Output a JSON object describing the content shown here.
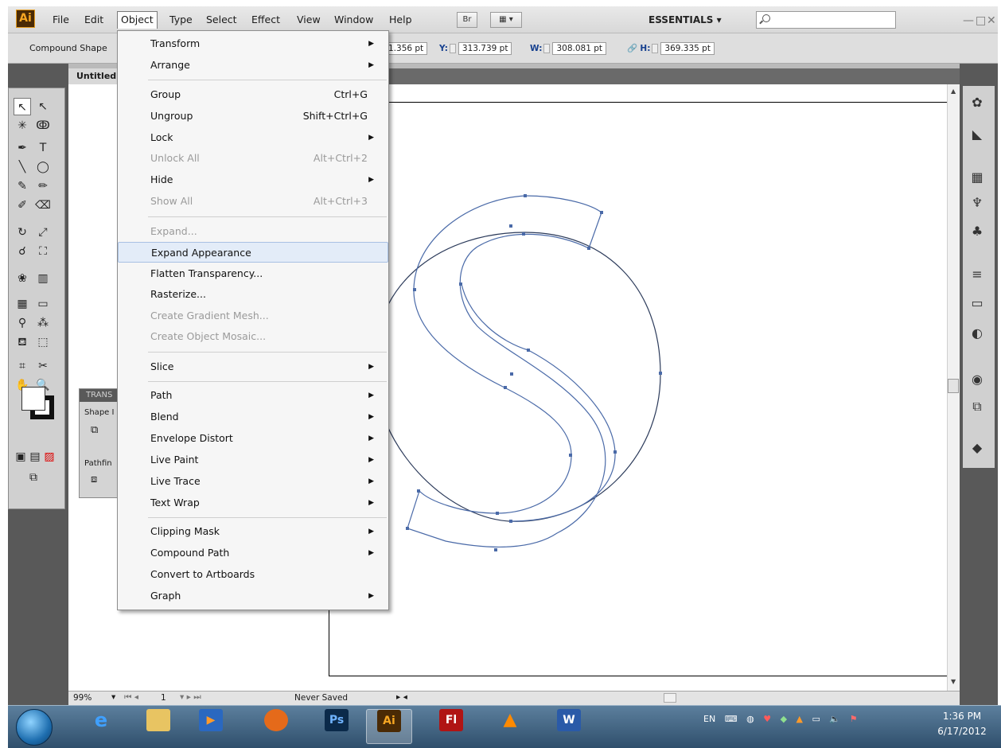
{
  "app": {
    "logo_text": "Ai",
    "menus": [
      "File",
      "Edit",
      "Object",
      "Type",
      "Select",
      "Effect",
      "View",
      "Window",
      "Help"
    ],
    "bridge_label": "Br",
    "workspace": "ESSENTIALS ▾",
    "search_placeholder": ""
  },
  "control_bar": {
    "label": "Compound Shape",
    "x_value": "1.356 pt",
    "y_label": "Y:",
    "y_value": "313.739 pt",
    "w_label": "W:",
    "w_value": "308.081 pt",
    "h_label": "H:",
    "h_value": "369.335 pt"
  },
  "document": {
    "tab": "Untitled"
  },
  "status_bar": {
    "zoom": "99%",
    "page": "1",
    "doc_status": "Never Saved"
  },
  "transform_panel": {
    "title": "TRANS",
    "shape_label": "Shape I",
    "pathfinder_label": "Pathfin"
  },
  "object_menu": {
    "items": [
      {
        "label": "Transform",
        "shortcut": "",
        "submenu": true,
        "disabled": false
      },
      {
        "label": "Arrange",
        "shortcut": "",
        "submenu": true,
        "disabled": false
      },
      {
        "label": "Group",
        "shortcut": "Ctrl+G",
        "submenu": false,
        "disabled": false
      },
      {
        "label": "Ungroup",
        "shortcut": "Shift+Ctrl+G",
        "submenu": false,
        "disabled": false
      },
      {
        "label": "Lock",
        "shortcut": "",
        "submenu": true,
        "disabled": false
      },
      {
        "label": "Unlock All",
        "shortcut": "Alt+Ctrl+2",
        "submenu": false,
        "disabled": true
      },
      {
        "label": "Hide",
        "shortcut": "",
        "submenu": true,
        "disabled": false
      },
      {
        "label": "Show All",
        "shortcut": "Alt+Ctrl+3",
        "submenu": false,
        "disabled": true
      },
      {
        "label": "Expand...",
        "shortcut": "",
        "submenu": false,
        "disabled": true
      },
      {
        "label": "Expand Appearance",
        "shortcut": "",
        "submenu": false,
        "disabled": false
      },
      {
        "label": "Flatten Transparency...",
        "shortcut": "",
        "submenu": false,
        "disabled": false
      },
      {
        "label": "Rasterize...",
        "shortcut": "",
        "submenu": false,
        "disabled": false
      },
      {
        "label": "Create Gradient Mesh...",
        "shortcut": "",
        "submenu": false,
        "disabled": true
      },
      {
        "label": "Create Object Mosaic...",
        "shortcut": "",
        "submenu": false,
        "disabled": true
      },
      {
        "label": "Slice",
        "shortcut": "",
        "submenu": true,
        "disabled": false
      },
      {
        "label": "Path",
        "shortcut": "",
        "submenu": true,
        "disabled": false
      },
      {
        "label": "Blend",
        "shortcut": "",
        "submenu": true,
        "disabled": false
      },
      {
        "label": "Envelope Distort",
        "shortcut": "",
        "submenu": true,
        "disabled": false
      },
      {
        "label": "Live Paint",
        "shortcut": "",
        "submenu": true,
        "disabled": false
      },
      {
        "label": "Live Trace",
        "shortcut": "",
        "submenu": true,
        "disabled": false
      },
      {
        "label": "Text Wrap",
        "shortcut": "",
        "submenu": true,
        "disabled": false
      },
      {
        "label": "Clipping Mask",
        "shortcut": "",
        "submenu": true,
        "disabled": false
      },
      {
        "label": "Compound Path",
        "shortcut": "",
        "submenu": true,
        "disabled": false
      },
      {
        "label": "Convert to Artboards",
        "shortcut": "",
        "submenu": false,
        "disabled": false
      },
      {
        "label": "Graph",
        "shortcut": "",
        "submenu": true,
        "disabled": false
      }
    ]
  },
  "taskbar": {
    "apps": [
      "Ie",
      "Explorer",
      "Media",
      "Firefox",
      "Ps",
      "Ai",
      "Fl",
      "VLC",
      "W"
    ],
    "language": "EN",
    "time": "1:36 PM",
    "date": "6/17/2012"
  },
  "colors": {
    "path_stroke": "#4a6aa8",
    "anchor_fill": "#4a6aa8",
    "menu_highlight": "#e3ecf8"
  }
}
